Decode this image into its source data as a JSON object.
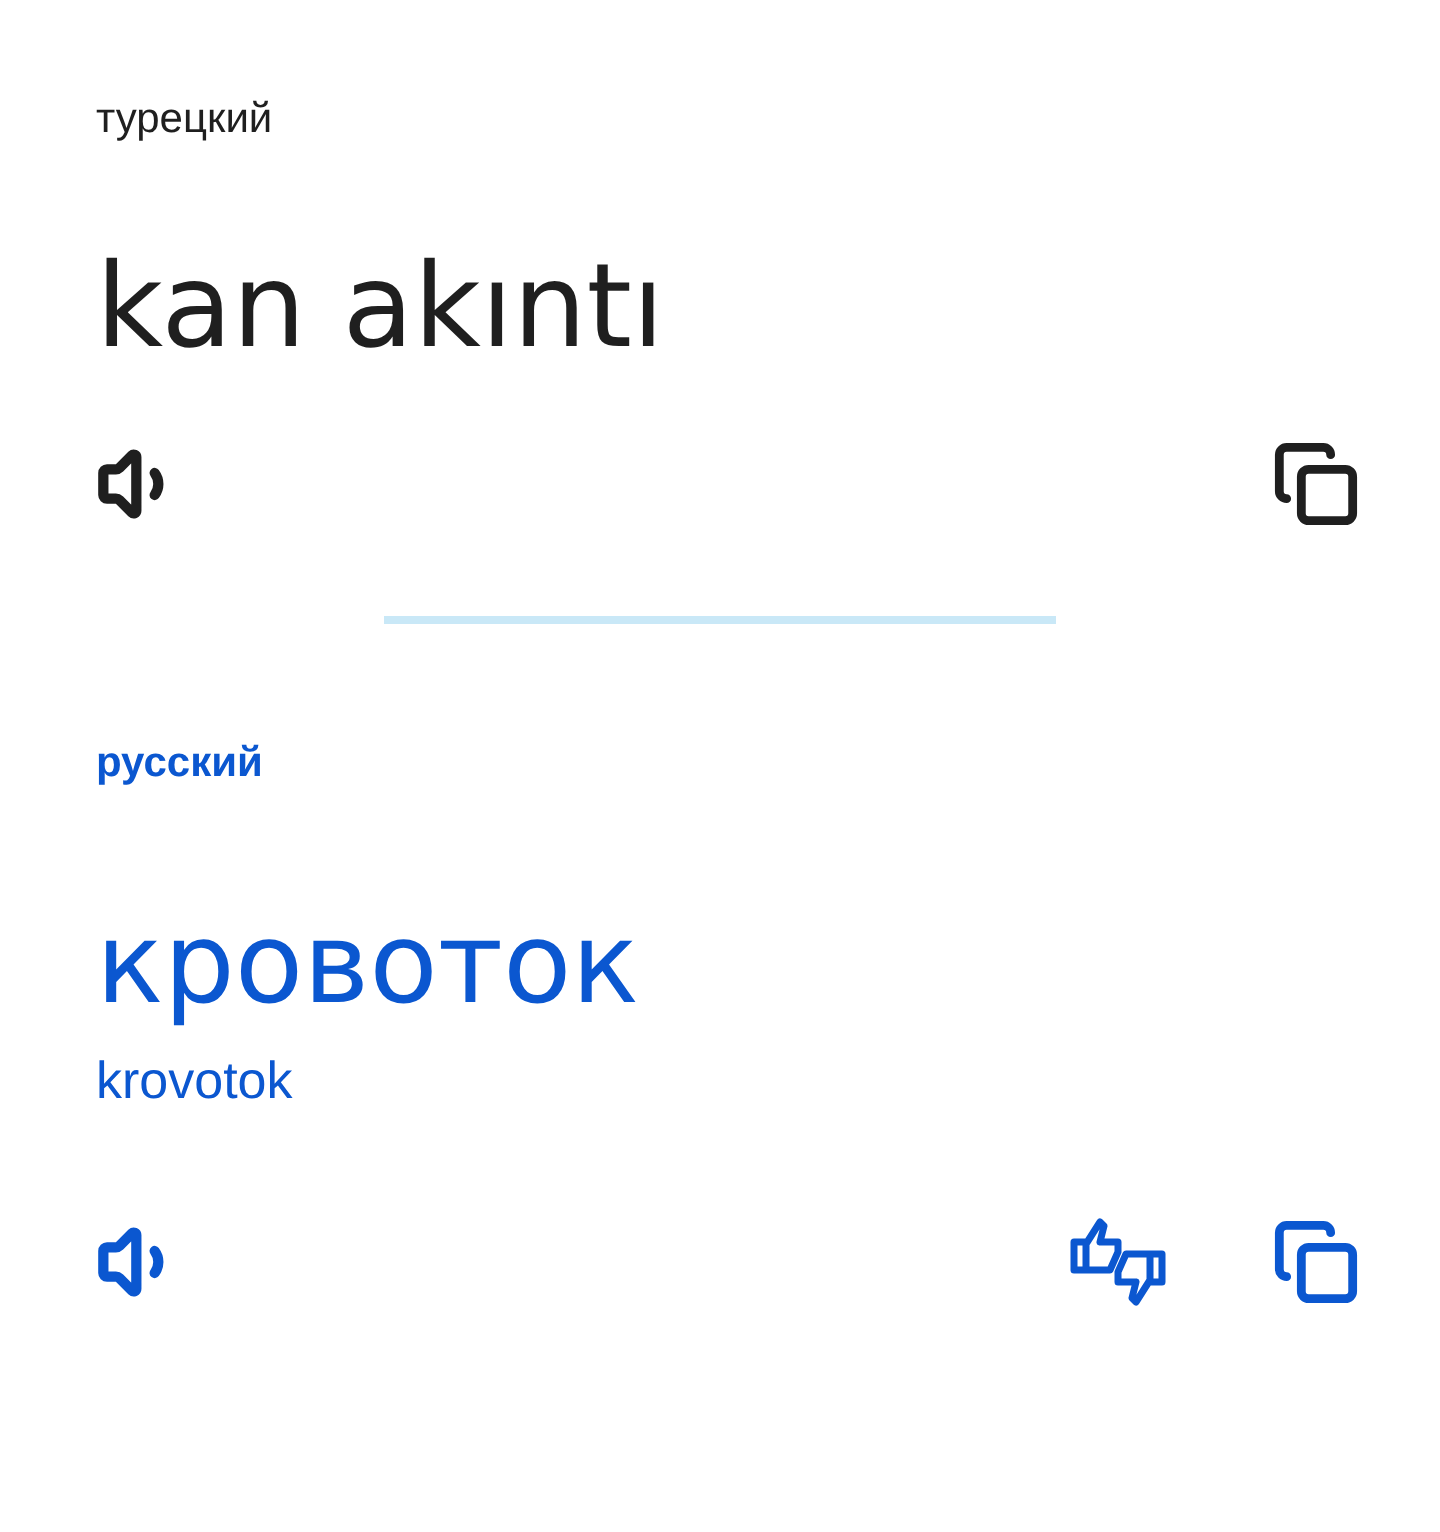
{
  "source": {
    "language": "турецкий",
    "text": "kan akıntı"
  },
  "target": {
    "language": "русский",
    "text": "кровоток",
    "transliteration": "krovotok"
  }
}
